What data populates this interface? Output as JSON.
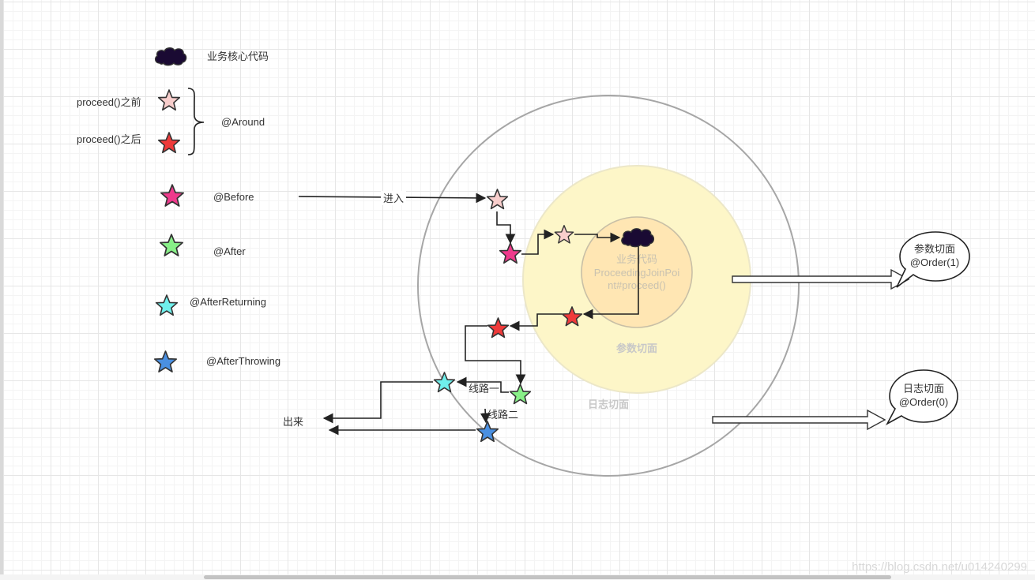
{
  "legend": {
    "core_code": "业务核心代码",
    "before_proceed": "proceed()之前",
    "after_proceed": "proceed()之后",
    "around": "@Around",
    "before": "@Before",
    "after": "@After",
    "after_returning": "@AfterReturning",
    "after_throwing": "@AfterThrowing"
  },
  "flow": {
    "enter": "进入",
    "exit": "出来",
    "route_one": "线路一",
    "route_two": "线路二"
  },
  "core": {
    "line1": "业务代码",
    "line2": "ProceedingJoinPoi",
    "line3": "nt#proceed()"
  },
  "regions": {
    "param_aspect": "参数切面",
    "log_aspect": "日志切面"
  },
  "callouts": {
    "param": {
      "title": "参数切面",
      "order": "@Order(1)"
    },
    "log": {
      "title": "日志切面",
      "order": "@Order(0)"
    }
  },
  "watermark": "https://blog.csdn.net/u014240299",
  "colors": {
    "cloud": "#1a0a33",
    "star_light_pink": "#f8cecc",
    "star_red": "#ef3a3a",
    "star_magenta": "#ef3a8c",
    "star_green": "#88f088",
    "star_cyan": "#6ff0ec",
    "star_blue": "#4a90e2",
    "outer_circle": "#a6a6a6",
    "middle_circle_fill": "#fdf6c8",
    "inner_circle_fill": "#ffe6b3"
  }
}
